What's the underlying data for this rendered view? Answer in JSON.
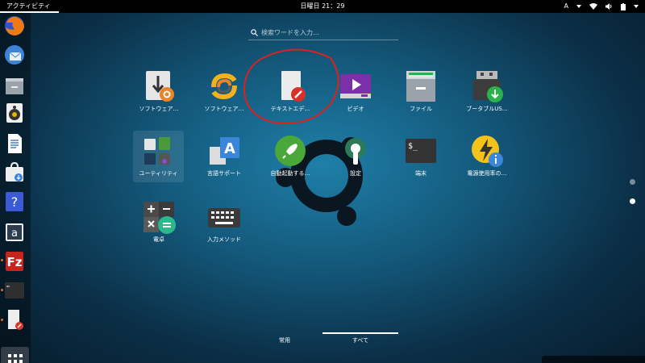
{
  "topbar": {
    "activities_label": "アクティビティ",
    "clock": "日曜日 21：29",
    "input_indicator": "A"
  },
  "search": {
    "placeholder": "検索ワードを入力…"
  },
  "dock": {
    "items": [
      "firefox",
      "thunderbird",
      "files",
      "rhythmbox",
      "writer",
      "software",
      "help",
      "amazon",
      "filezilla",
      "terminal",
      "text-editor"
    ]
  },
  "apps": {
    "row1": [
      {
        "label": "ソフトウェア…"
      },
      {
        "label": "ソフトウェア…"
      },
      {
        "label": "テキストエデ…"
      },
      {
        "label": "ビデオ"
      },
      {
        "label": "ファイル"
      },
      {
        "label": "ブータブルUS…"
      }
    ],
    "row2": [
      {
        "label": "ユーティリティ"
      },
      {
        "label": "言語サポート"
      },
      {
        "label": "自動起動する…"
      },
      {
        "label": "設定"
      },
      {
        "label": "端末"
      },
      {
        "label": "電源使用率の…"
      }
    ],
    "row3": [
      {
        "label": "電卓"
      },
      {
        "label": "入力メソッド"
      }
    ]
  },
  "tabs": {
    "frequent": "常用",
    "all": "すべて"
  },
  "colors": {
    "accent_orange": "#e8842a",
    "annotation_red": "#d9231f",
    "video_purple": "#7b2fa8",
    "download_green": "#2bb24c"
  }
}
